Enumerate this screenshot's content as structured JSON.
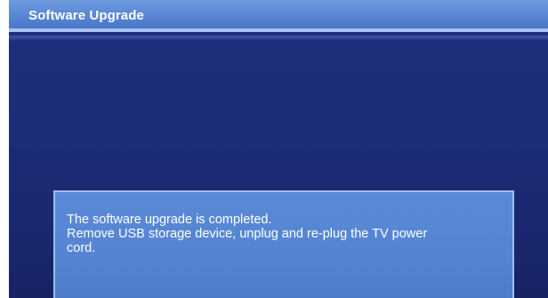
{
  "header": {
    "title": "Software Upgrade"
  },
  "dialog": {
    "lines": [
      "The software upgrade is completed.",
      "Remove USB storage device, unplug and re-plug the TV power",
      "cord."
    ]
  },
  "colors": {
    "background": "#1d2c78",
    "title_bar": "#5b88d6",
    "message_box": "#5585d2",
    "text": "#ffffff"
  }
}
